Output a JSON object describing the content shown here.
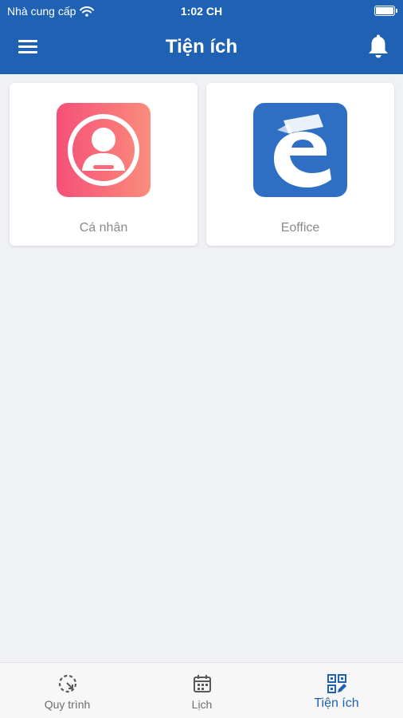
{
  "status_bar": {
    "carrier": "Nhà cung cấp",
    "time": "1:02 CH"
  },
  "header": {
    "title": "Tiện ích"
  },
  "apps": [
    {
      "label": "Cá nhân",
      "icon": "person-icon",
      "colors": [
        "#f54f78",
        "#fb8d7c"
      ]
    },
    {
      "label": "Eoffice",
      "icon": "eoffice-logo-icon",
      "colors": [
        "#2e6fc4",
        "#2e6fc4"
      ]
    }
  ],
  "tabs": [
    {
      "label": "Quy trình",
      "icon": "process-icon",
      "active": false
    },
    {
      "label": "Lịch",
      "icon": "calendar-icon",
      "active": false
    },
    {
      "label": "Tiện ích",
      "icon": "qr-edit-icon",
      "active": true
    }
  ],
  "colors": {
    "primary": "#1f62b3",
    "background": "#eff1f5",
    "label": "#8a8a8a"
  }
}
